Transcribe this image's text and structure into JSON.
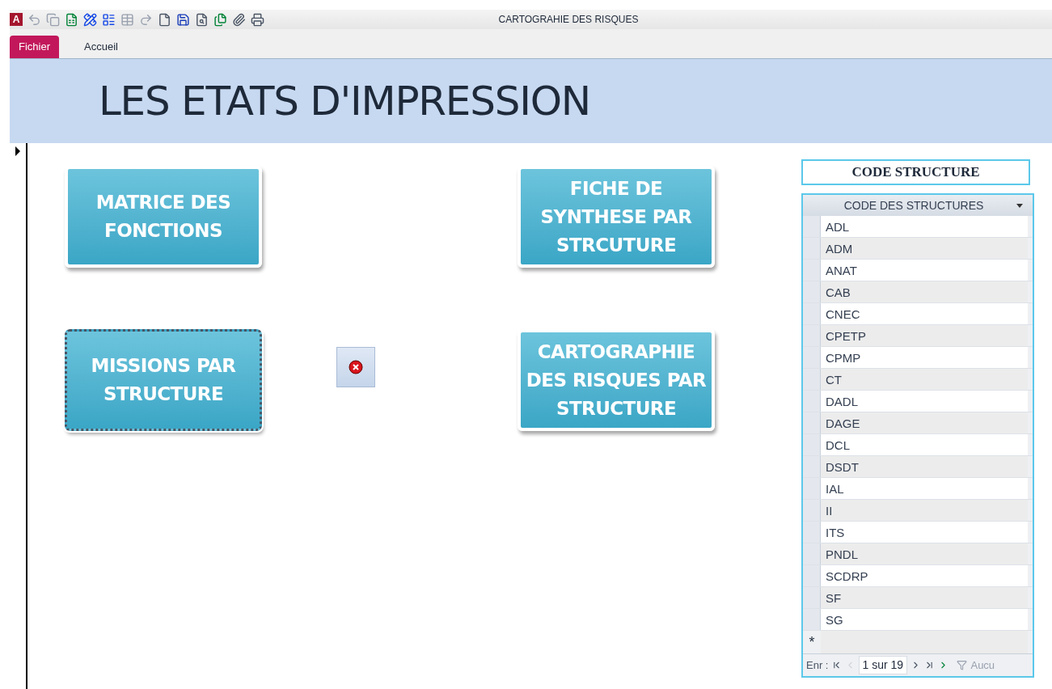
{
  "window": {
    "title": "CARTOGRAHIE DES RISQUES",
    "app_icon": "A"
  },
  "ribbon_tabs": [
    {
      "label": "Fichier",
      "selected": true
    },
    {
      "label": "Accueil",
      "selected": false
    }
  ],
  "header": {
    "title": "LES ETATS D'IMPRESSION"
  },
  "report_buttons": [
    {
      "label": "MATRICE DES\nFONCTIONS",
      "focused": false
    },
    {
      "label": "FICHE DE\nSYNTHESE PAR\nSTRCUTURE",
      "focused": false
    },
    {
      "label": "MISSIONS PAR\nSTRUCTURE",
      "focused": true
    },
    {
      "label": "CARTOGRAPHIE\nDES RISQUES PAR\nSTRUCTURE",
      "focused": false
    }
  ],
  "code_label": "CODE STRUCTURE",
  "datasheet": {
    "column": "CODE DES STRUCTURES",
    "rows": [
      "ADL",
      "ADM",
      "ANAT",
      "CAB",
      "CNEC",
      "CPETP",
      "CPMP",
      "CT",
      "DADL",
      "DAGE",
      "DCL",
      "DSDT",
      "IAL",
      "II",
      "ITS",
      "PNDL",
      "SCDRP",
      "SF",
      "SG"
    ],
    "new_row_marker": "*",
    "navigation": {
      "label": "Enr :",
      "position": "1 sur 19",
      "filter": "Aucu"
    }
  }
}
